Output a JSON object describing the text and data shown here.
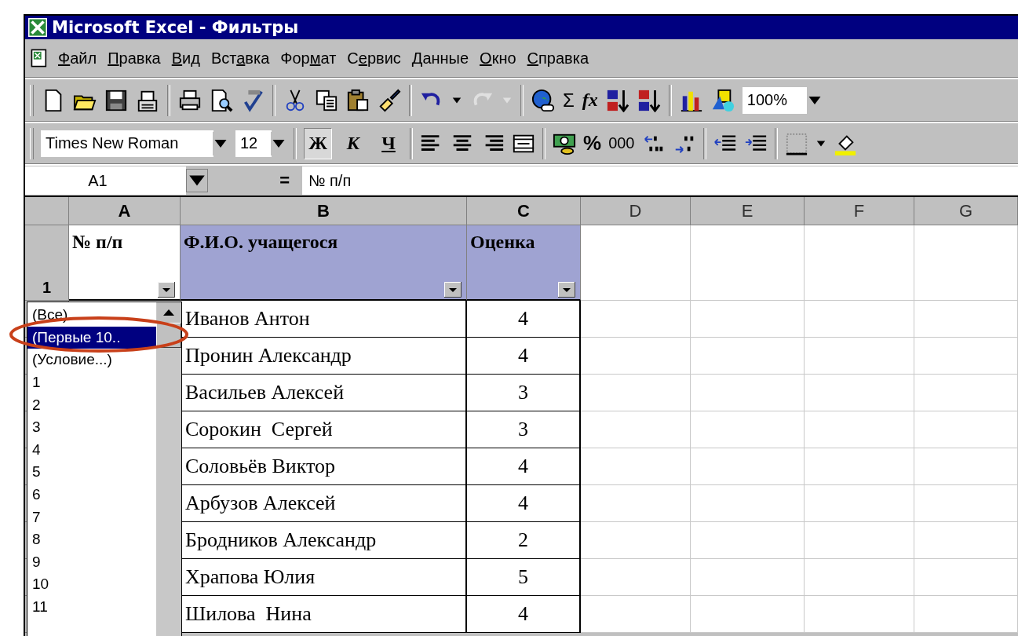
{
  "window": {
    "title": "Microsoft Excel - Фильтры"
  },
  "menu": [
    {
      "key": "Ф",
      "after": "айл"
    },
    {
      "key": "П",
      "after": "равка"
    },
    {
      "key": "В",
      "after": "ид"
    },
    {
      "before": "Вст",
      "key": "а",
      "after": "вка"
    },
    {
      "before": "Фор",
      "key": "м",
      "after": "ат"
    },
    {
      "before": "С",
      "key": "е",
      "after": "рвис"
    },
    {
      "key": "Д",
      "after": "анные"
    },
    {
      "key": "О",
      "after": "кно"
    },
    {
      "key": "С",
      "after": "правка"
    }
  ],
  "standard_toolbar": {
    "sum": "Σ",
    "function": "fx",
    "zoom": "100%"
  },
  "format_toolbar": {
    "font": "Times New Roman",
    "size": "12",
    "percent": "%",
    "thousands": "000",
    "styles": [
      {
        "label": "Ж",
        "kind": "bold",
        "pressed": true
      },
      {
        "label": "К",
        "kind": "italic",
        "pressed": false
      },
      {
        "label": "Ч",
        "kind": "underline",
        "pressed": false
      }
    ]
  },
  "formula_bar": {
    "name_box": "A1",
    "equals": "=",
    "content": "№ п/п"
  },
  "sheet": {
    "columns": [
      {
        "label": "A",
        "highlighted": true
      },
      {
        "label": "B",
        "highlighted": true
      },
      {
        "label": "C",
        "highlighted": true
      },
      {
        "label": "D",
        "highlighted": false
      },
      {
        "label": "E",
        "highlighted": false
      },
      {
        "label": "F",
        "highlighted": false
      },
      {
        "label": "G",
        "highlighted": false
      }
    ],
    "header_row": {
      "number": "1",
      "cells": [
        {
          "text": "№ п/п",
          "shaded": false
        },
        {
          "text": "Ф.И.О. учащегося",
          "shaded": true
        },
        {
          "text": "Оценка",
          "shaded": true
        }
      ]
    },
    "rows": [
      {
        "name": "Иванов Антон",
        "grade": "4"
      },
      {
        "name": "Пронин Александр",
        "grade": "4"
      },
      {
        "name": "Васильев Алексей",
        "grade": "3"
      },
      {
        "name": "Сорокин  Сергей",
        "grade": "3"
      },
      {
        "name": "Соловьёв Виктор",
        "grade": "4"
      },
      {
        "name": "Арбузов Алексей",
        "grade": "4"
      },
      {
        "name": "Бродников Александр",
        "grade": "2"
      },
      {
        "name": "Храпова Юлия",
        "grade": "5"
      },
      {
        "name": "Шилова  Нина",
        "grade": "4"
      }
    ]
  },
  "filter_list": {
    "items": [
      {
        "label": "(Все)",
        "selected": false
      },
      {
        "label": "(Первые 10..",
        "selected": true
      },
      {
        "label": "(Условие...)",
        "selected": false
      },
      {
        "label": "1",
        "selected": false
      },
      {
        "label": "2",
        "selected": false
      },
      {
        "label": "3",
        "selected": false
      },
      {
        "label": "4",
        "selected": false
      },
      {
        "label": "5",
        "selected": false
      },
      {
        "label": "6",
        "selected": false
      },
      {
        "label": "7",
        "selected": false
      },
      {
        "label": "8",
        "selected": false
      },
      {
        "label": "9",
        "selected": false
      },
      {
        "label": "10",
        "selected": false
      },
      {
        "label": "11",
        "selected": false
      }
    ]
  }
}
